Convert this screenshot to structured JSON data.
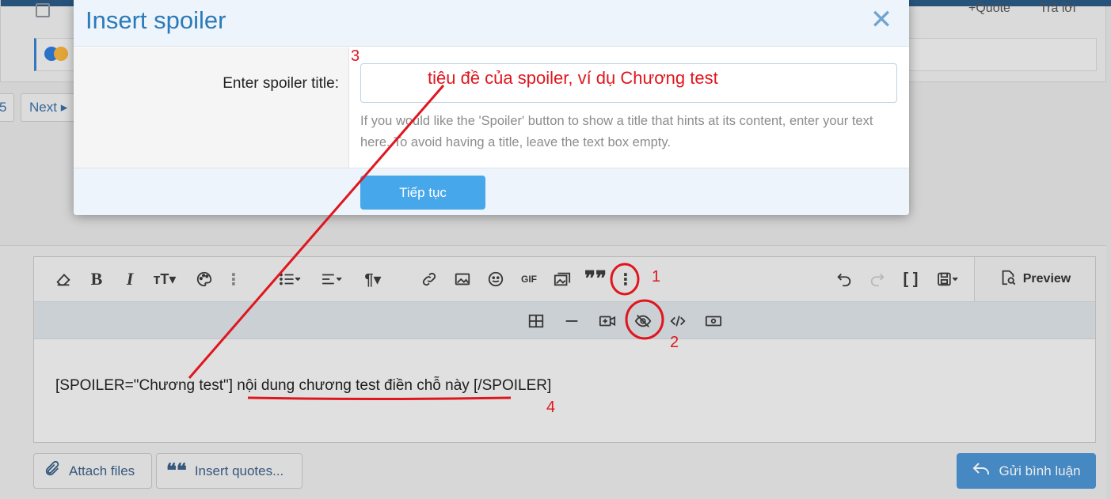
{
  "background": {
    "quote_label": "+Quote",
    "reply_label": "Trả lời",
    "page_number": "5",
    "next_label": "Next"
  },
  "modal": {
    "title": "Insert spoiler",
    "close_icon": "close-icon",
    "field_label": "Enter spoiler title:",
    "field_value": "",
    "hint": "If you would like the 'Spoiler' button to show a title that hints at its content, enter your text here. To avoid having a title, leave the text box empty.",
    "continue_label": "Tiếp tục"
  },
  "editor": {
    "toolbar_row1": [
      "eraser-icon",
      "bold-icon",
      "italic-icon",
      "text-size-icon",
      "palette-icon",
      "more-options-icon",
      "list-icon",
      "align-icon",
      "paragraph-icon",
      "link-icon",
      "image-icon",
      "smile-icon",
      "gif-icon",
      "media-icon",
      "quote-icon",
      "vertical-dots-icon",
      "undo-icon",
      "redo-icon",
      "brackets-icon",
      "save-draft-icon"
    ],
    "toolbar_row2": [
      "table-icon",
      "horizontal-rule-icon",
      "video-icon",
      "eye-slash-icon",
      "code-icon",
      "money-icon"
    ],
    "preview_label": "Preview",
    "content": "[SPOILER=\"Chương test\"] nội dung chương test điền chỗ này [/SPOILER]"
  },
  "footer": {
    "attach_label": "Attach files",
    "quotes_label": "Insert quotes...",
    "send_label": "Gửi bình luận"
  },
  "annotations": {
    "step1": "1",
    "step2": "2",
    "step3": "3",
    "step4": "4",
    "title_example": "tiêu đề của spoiler, ví dụ Chương test",
    "color": "#e0161e"
  }
}
